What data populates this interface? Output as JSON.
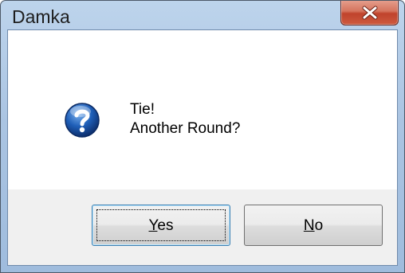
{
  "window": {
    "title": "Damka"
  },
  "message": {
    "icon": "question-icon",
    "line1": "Tie!",
    "line2": "Another Round?"
  },
  "buttons": {
    "yes": {
      "mnemonic": "Y",
      "rest": "es"
    },
    "no": {
      "mnemonic": "N",
      "rest": "o"
    }
  },
  "colors": {
    "title_bar": "#aac4e2",
    "close_button": "#c0432c",
    "icon_blue": "#1f5fb8"
  }
}
